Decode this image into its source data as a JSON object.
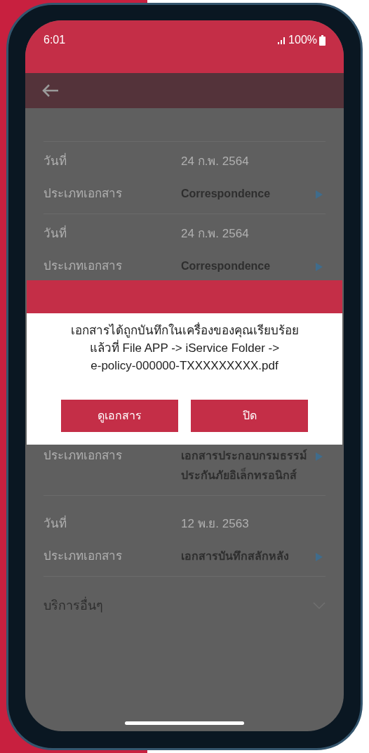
{
  "status_bar": {
    "time": "6:01",
    "battery": "100%"
  },
  "documents": [
    {
      "date_label": "วันที่",
      "date": "24 ก.พ. 2564",
      "type_label": "ประเภทเอกสาร",
      "type": "Correspondence"
    },
    {
      "date_label": "วันที่",
      "date": "24 ก.พ. 2564",
      "type_label": "ประเภทเอกสาร",
      "type": "Correspondence"
    },
    {
      "type_label": "ประเภทเอกสาร",
      "type": "เอกสารประกอบกรมธรรม์\nประกันภัยอิเล็กทรอนิกส์"
    },
    {
      "date_label": "วันที่",
      "date": "12 พ.ย. 2563",
      "type_label": "ประเภทเอกสาร",
      "type": "เอกสารบันทึกสลักหลัง"
    }
  ],
  "dialog": {
    "message": "เอกสารได้ถูกบันทึกในเครื่องของคุณเรียบร้อย\nแล้วที่ File APP -> iService Folder ->\ne-policy-000000-TXXXXXXXXX.pdf",
    "buttons": [
      "ดูเอกสาร",
      "ปิด"
    ]
  },
  "other_services": {
    "label": "บริการอื่นๆ",
    "expanded": false
  }
}
